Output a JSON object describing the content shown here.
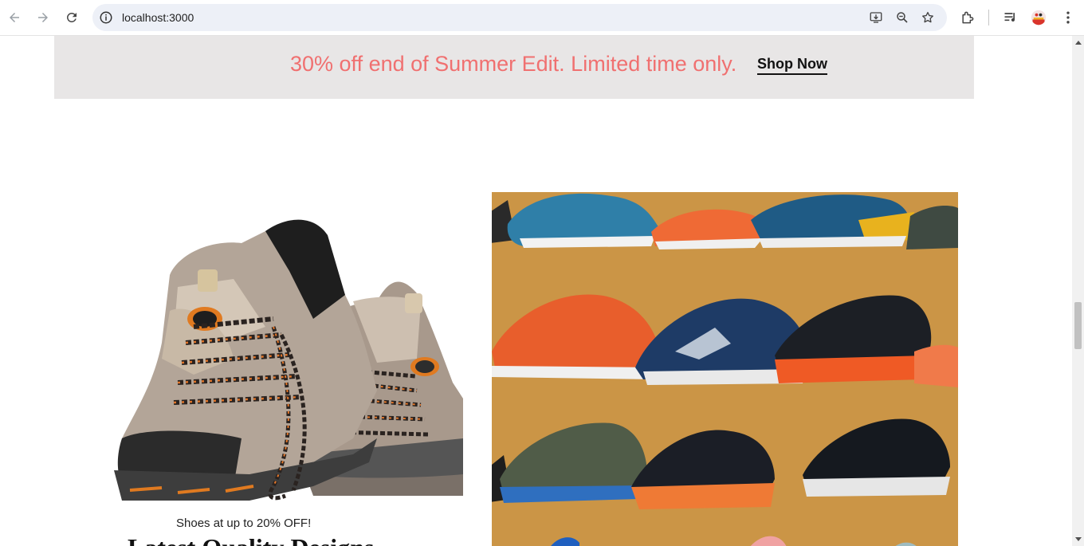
{
  "browser": {
    "url": "localhost:3000",
    "icons": [
      "back-icon",
      "forward-icon",
      "reload-icon",
      "site-info-icon",
      "install-app-icon",
      "zoom-icon",
      "bookmark-star-icon",
      "extensions-icon",
      "reading-list-icon",
      "profile-avatar",
      "menu-dots-icon"
    ]
  },
  "promo": {
    "text": "30% off end of Summer Edit. Limited time only.",
    "link": "Shop Now",
    "text_color": "#f07070",
    "background": "#e8e6e6"
  },
  "featured": {
    "caption": "Shoes at up to 20% OFF!",
    "heading": "Latest Quality Designs"
  },
  "colors": {
    "sneaker_background": "#cb9546"
  }
}
